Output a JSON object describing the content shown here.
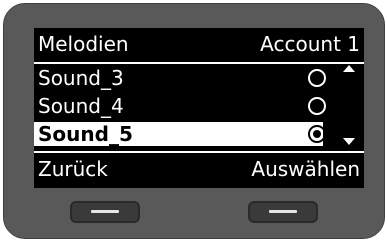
{
  "header": {
    "title": "Melodien",
    "account": "Account 1"
  },
  "list": {
    "items": [
      {
        "label": "Sound_3",
        "selected": false,
        "checked": false
      },
      {
        "label": "Sound_4",
        "selected": false,
        "checked": false
      },
      {
        "label": "Sound_5",
        "selected": true,
        "checked": true
      }
    ]
  },
  "softkeys": {
    "left_label": "Zurück",
    "right_label": "Auswählen"
  },
  "icons": {
    "scroll_up": "triangle-up-icon",
    "scroll_down": "triangle-down-icon",
    "radio_empty": "radio-unchecked-icon",
    "radio_checked": "radio-checked-icon",
    "softkey_bar": "dash-icon"
  },
  "colors": {
    "bezel": "#565656",
    "screen_bg": "#000000",
    "screen_fg": "#ffffff",
    "selection_bg": "#ffffff",
    "key": "#3a3a3a"
  }
}
